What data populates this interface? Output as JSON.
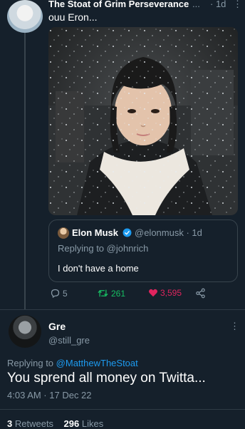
{
  "quoted_tweet": {
    "author_name": "The Stoat of Grim Perseverance",
    "name_truncation": "...",
    "time": "· 1d",
    "more": "⋮",
    "text": "ouu Eron...",
    "nested_quote": {
      "name": "Elon Musk",
      "handle_time": "@elonmusk · 1d",
      "reply_to": "Replying to @johnrich",
      "text": "I don't have a home"
    },
    "actions": {
      "replies": "5",
      "retweets": "261",
      "likes": "3,595"
    }
  },
  "main_tweet": {
    "name": "Gre",
    "handle": "@still_gre",
    "more": "⋮",
    "reply_prefix": "Replying to",
    "reply_mention": "@MatthewTheStoat",
    "text": "You sprend all money on Twitta...",
    "timestamp": "4:03 AM · 17 Dec 22"
  },
  "stats": {
    "retweets_count": "3",
    "retweets_label": "Retweets",
    "likes_count": "296",
    "likes_label": "Likes"
  },
  "colors": {
    "background": "#15202b",
    "secondary_text": "#8899a6",
    "link": "#1d9bf0",
    "retweet": "#17bf63",
    "like": "#e0245e"
  }
}
